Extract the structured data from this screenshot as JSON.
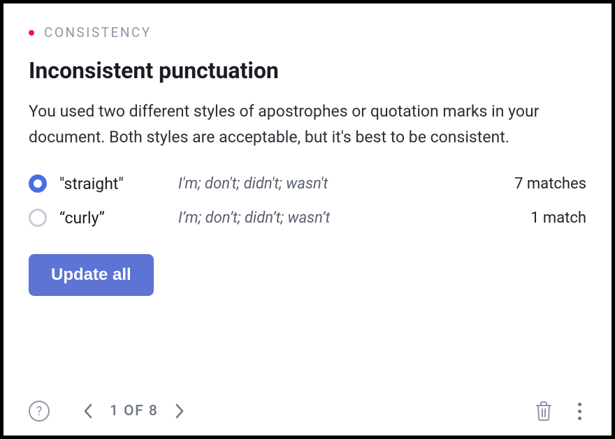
{
  "category": "CONSISTENCY",
  "title": "Inconsistent punctuation",
  "description": "You used two different styles of apostrophes or quotation marks in your document. Both styles are acceptable, but it's best to be consistent.",
  "options": [
    {
      "label": "\"straight\"",
      "examples": "I'm; don't; didn't; wasn't",
      "matches": "7 matches",
      "selected": true
    },
    {
      "label": "“curly”",
      "examples": "I’m; don’t; didn’t; wasn’t",
      "matches": "1 match",
      "selected": false
    }
  ],
  "button_label": "Update all",
  "pager": {
    "text": "1 OF 8"
  }
}
